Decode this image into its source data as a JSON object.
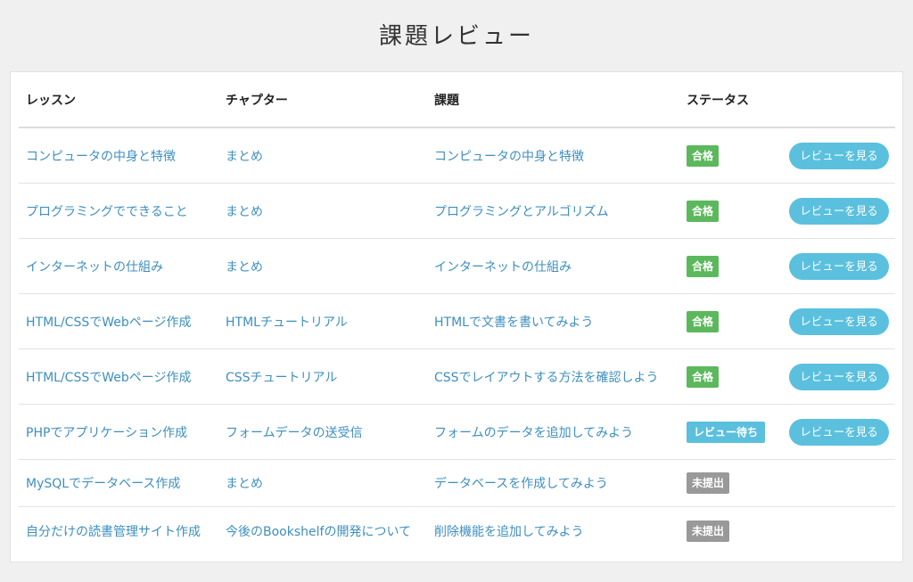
{
  "page": {
    "title": "課題レビュー"
  },
  "table": {
    "headers": {
      "lesson": "レッスン",
      "chapter": "チャプター",
      "task": "課題",
      "status": "ステータス"
    },
    "rows": [
      {
        "lesson": "コンピュータの中身と特徴",
        "chapter": "まとめ",
        "task": "コンピュータの中身と特徴",
        "status": "合格",
        "status_kind": "pass",
        "button": "レビューを見る"
      },
      {
        "lesson": "プログラミングでできること",
        "chapter": "まとめ",
        "task": "プログラミングとアルゴリズム",
        "status": "合格",
        "status_kind": "pass",
        "button": "レビューを見る"
      },
      {
        "lesson": "インターネットの仕組み",
        "chapter": "まとめ",
        "task": "インターネットの仕組み",
        "status": "合格",
        "status_kind": "pass",
        "button": "レビューを見る"
      },
      {
        "lesson": "HTML/CSSでWebページ作成",
        "chapter": "HTMLチュートリアル",
        "task": "HTMLで文書を書いてみよう",
        "status": "合格",
        "status_kind": "pass",
        "button": "レビューを見る"
      },
      {
        "lesson": "HTML/CSSでWebページ作成",
        "chapter": "CSSチュートリアル",
        "task": "CSSでレイアウトする方法を確認しよう",
        "status": "合格",
        "status_kind": "pass",
        "button": "レビューを見る"
      },
      {
        "lesson": "PHPでアプリケーション作成",
        "chapter": "フォームデータの送受信",
        "task": "フォームのデータを追加してみよう",
        "status": "レビュー待ち",
        "status_kind": "waiting",
        "button": "レビューを見る"
      },
      {
        "lesson": "MySQLでデータベース作成",
        "chapter": "まとめ",
        "task": "データベースを作成してみよう",
        "status": "未提出",
        "status_kind": "none",
        "button": ""
      },
      {
        "lesson": "自分だけの読書管理サイト作成",
        "chapter": "今後のBookshelfの開発について",
        "task": "削除機能を追加してみよう",
        "status": "未提出",
        "status_kind": "none",
        "button": ""
      }
    ]
  },
  "colors": {
    "background": "#f0f0f0",
    "link": "#3d8fbe",
    "pass": "#5cb85c",
    "waiting": "#5bc0de",
    "not_submitted": "#999999",
    "button": "#5bc0de"
  }
}
